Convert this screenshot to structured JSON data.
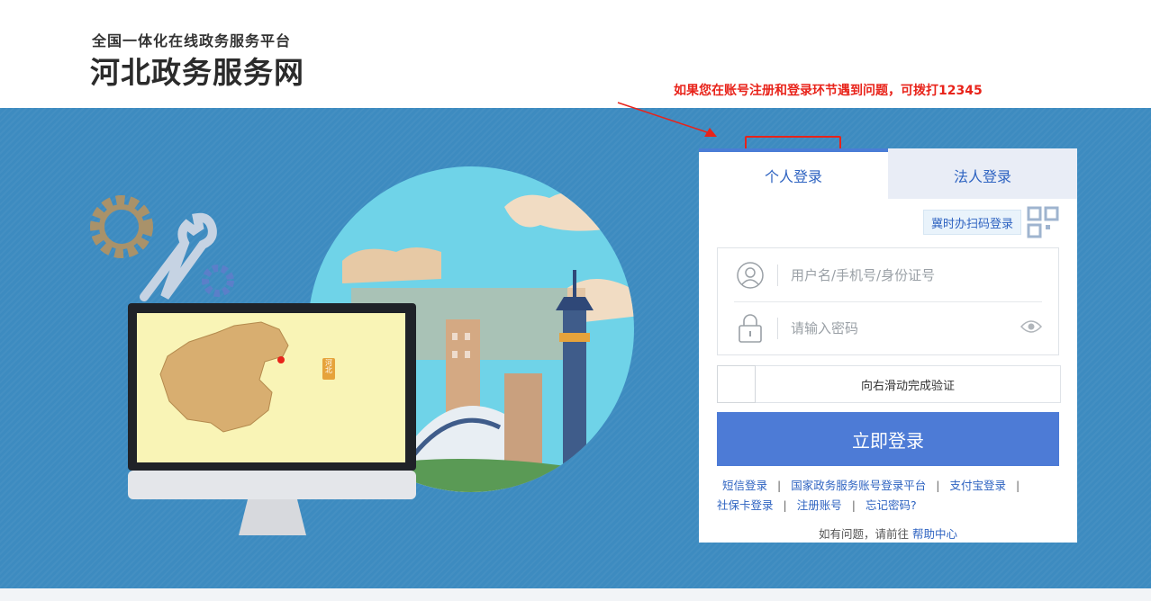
{
  "header": {
    "subtitle": "全国一体化在线政务服务平台",
    "title": "河北政务服务网"
  },
  "notice": "如果您在账号注册和登录环节遇到问题，可拨打12345",
  "illustration": {
    "map_label": "河北"
  },
  "login": {
    "tabs": [
      {
        "label": "个人登录",
        "active": true
      },
      {
        "label": "法人登录",
        "active": false
      }
    ],
    "qr_label": "冀时办扫码登录",
    "username_placeholder": "用户名/手机号/身份证号",
    "password_placeholder": "请输入密码",
    "slider_text": "向右滑动完成验证",
    "submit_label": "立即登录",
    "links": [
      "短信登录",
      "国家政务服务账号登录平台",
      "支付宝登录",
      "社保卡登录",
      "注册账号",
      "忘记密码?"
    ],
    "help_prefix": "如有问题，请前往",
    "help_link": "帮助中心"
  },
  "colors": {
    "banner": "#3d8bc0",
    "accent": "#4d7bd6",
    "notice": "#e8231a"
  }
}
